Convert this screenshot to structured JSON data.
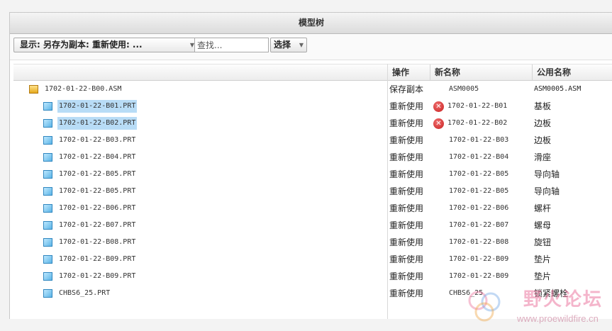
{
  "panel": {
    "title": "模型树"
  },
  "toolbar": {
    "display_label": "显示: 另存为副本: 重新使用: ...",
    "search_placeholder": "查找...",
    "select_label": "选择"
  },
  "columns": {
    "operation": "操作",
    "new_name": "新名称",
    "common_name": "公用名称"
  },
  "tree": [
    {
      "name": "1702-01-22-B00.ASM",
      "type": "assembly",
      "selected": false,
      "operation": "保存副本",
      "error": false,
      "new_name": "ASM0005",
      "common_name": "ASM0005.ASM"
    },
    {
      "name": "1702-01-22-B01.PRT",
      "type": "part",
      "selected": true,
      "operation": "重新使用",
      "error": true,
      "new_name": "1702-01-22-B01",
      "common_name": "基板"
    },
    {
      "name": "1702-01-22-B02.PRT",
      "type": "part",
      "selected": true,
      "operation": "重新使用",
      "error": true,
      "new_name": "1702-01-22-B02",
      "common_name": "边板"
    },
    {
      "name": "1702-01-22-B03.PRT",
      "type": "part",
      "selected": false,
      "operation": "重新使用",
      "error": false,
      "new_name": "1702-01-22-B03",
      "common_name": "边板"
    },
    {
      "name": "1702-01-22-B04.PRT",
      "type": "part",
      "selected": false,
      "operation": "重新使用",
      "error": false,
      "new_name": "1702-01-22-B04",
      "common_name": "滑座"
    },
    {
      "name": "1702-01-22-B05.PRT",
      "type": "part",
      "selected": false,
      "operation": "重新使用",
      "error": false,
      "new_name": "1702-01-22-B05",
      "common_name": "导向轴"
    },
    {
      "name": "1702-01-22-B05.PRT",
      "type": "part",
      "selected": false,
      "operation": "重新使用",
      "error": false,
      "new_name": "1702-01-22-B05",
      "common_name": "导向轴"
    },
    {
      "name": "1702-01-22-B06.PRT",
      "type": "part",
      "selected": false,
      "operation": "重新使用",
      "error": false,
      "new_name": "1702-01-22-B06",
      "common_name": "螺杆"
    },
    {
      "name": "1702-01-22-B07.PRT",
      "type": "part",
      "selected": false,
      "operation": "重新使用",
      "error": false,
      "new_name": "1702-01-22-B07",
      "common_name": "螺母"
    },
    {
      "name": "1702-01-22-B08.PRT",
      "type": "part",
      "selected": false,
      "operation": "重新使用",
      "error": false,
      "new_name": "1702-01-22-B08",
      "common_name": "旋钮"
    },
    {
      "name": "1702-01-22-B09.PRT",
      "type": "part",
      "selected": false,
      "operation": "重新使用",
      "error": false,
      "new_name": "1702-01-22-B09",
      "common_name": "垫片"
    },
    {
      "name": "1702-01-22-B09.PRT",
      "type": "part",
      "selected": false,
      "operation": "重新使用",
      "error": false,
      "new_name": "1702-01-22-B09",
      "common_name": "垫片"
    },
    {
      "name": "CHBS6_25.PRT",
      "type": "part",
      "selected": false,
      "operation": "重新使用",
      "error": false,
      "new_name": "CHBS6_25",
      "common_name": "锁紧螺栓"
    }
  ],
  "watermark": {
    "title": "野火论坛",
    "url": "www.proewildfire.cn"
  },
  "icons": {
    "assembly": "assembly-icon",
    "part": "part-icon",
    "error": "error-icon",
    "dropdown": "chevron-down-icon"
  },
  "colors": {
    "selection": "#b8dcf6",
    "error": "#d42a2a",
    "part_icon": "#5bb4e6",
    "assembly_icon": "#e5a91d"
  }
}
